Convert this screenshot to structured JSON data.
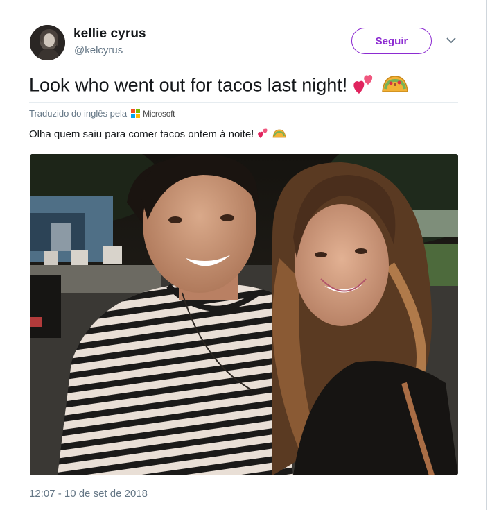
{
  "tweet": {
    "display_name": "kellie cyrus",
    "handle": "@kelcyrus",
    "follow_label": "Seguir",
    "text": "Look who went out for tacos last night!",
    "translated_by": "Traduzido do inglês pela",
    "translator_brand": "Microsoft",
    "translation": "Olha quem saiu para comer tacos ontem à noite!",
    "timestamp": "12:07 - 10 de set de 2018"
  },
  "icons": {
    "emojis": [
      "two-hearts-icon",
      "taco-icon"
    ],
    "menu": "chevron-down-icon",
    "translator": "microsoft-logo-icon"
  },
  "colors": {
    "accent": "#8c2bd1",
    "secondary_text": "#657786",
    "primary_text": "#14171a",
    "ms_red": "#f25022",
    "ms_green": "#7fba00",
    "ms_blue": "#00a4ef",
    "ms_yellow": "#ffb900"
  }
}
